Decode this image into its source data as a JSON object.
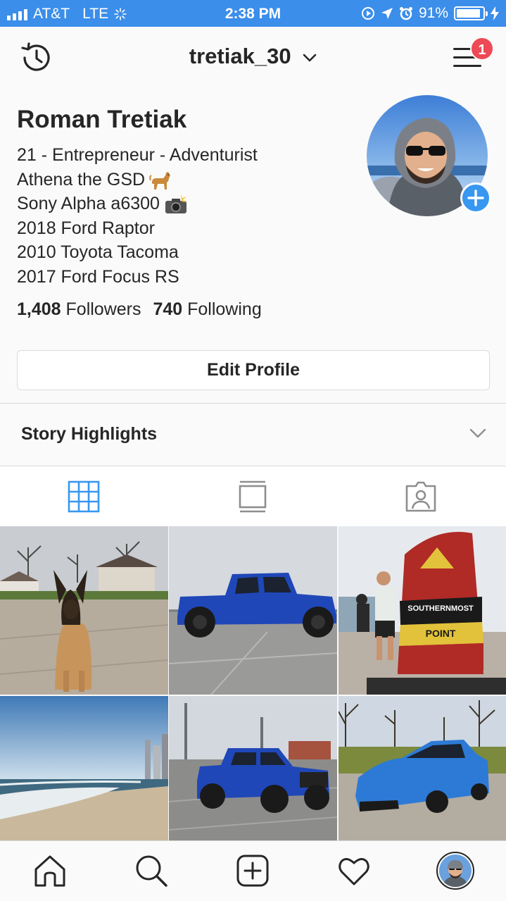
{
  "status_bar": {
    "carrier": "AT&T",
    "network": "LTE",
    "time": "2:38 PM",
    "battery": "91%",
    "battery_level": 0.91
  },
  "header": {
    "username": "tretiak_30",
    "notification_count": "1"
  },
  "profile": {
    "name": "Roman Tretiak",
    "bio": {
      "line1": "21 - Entrepreneur - Adventurist",
      "line2": "Athena the GSD",
      "line3": "Sony Alpha a6300",
      "line4": "2018 Ford Raptor",
      "line5": "2010 Toyota Tacoma",
      "line6": "2017 Ford Focus RS"
    },
    "followers_count": "1,408",
    "followers_label": "Followers",
    "following_count": "740",
    "following_label": "Following",
    "edit_button": "Edit Profile"
  },
  "highlights": {
    "label": "Story Highlights"
  },
  "tabs": [
    "grid-view",
    "feed-view",
    "tagged-view"
  ],
  "posts": [
    "german-shepherd-dog",
    "blue-ford-raptor",
    "southernmost-point-buoy",
    "beach-shoreline",
    "blue-raptor-parking-lot",
    "blue-ford-focus-rs"
  ],
  "colors": {
    "accent": "#3897f0",
    "status_bar": "#3b8eea",
    "badge": "#ed4956",
    "text": "#262626",
    "border": "#dbdbdb"
  }
}
